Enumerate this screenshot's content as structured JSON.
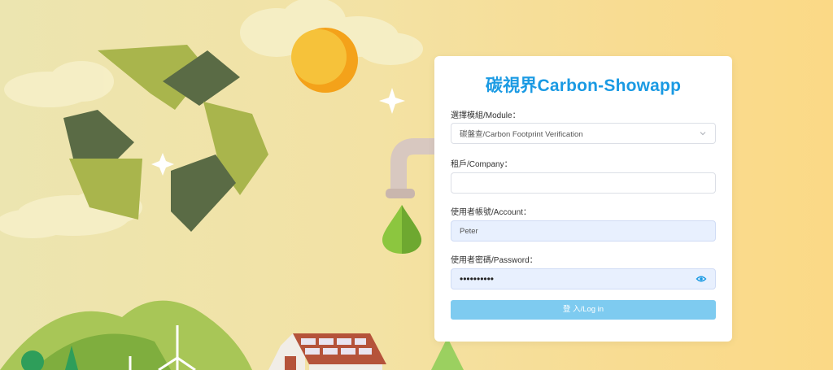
{
  "app": {
    "title": "碳視界Carbon-Showapp"
  },
  "form": {
    "module_label": "選擇模組/Module：",
    "module_value": "碳盤查/Carbon Footprint Verification",
    "company_label": "租戶/Company：",
    "company_value": "",
    "account_label": "使用者帳號/Account：",
    "account_value": "Peter",
    "password_label": "使用者密碼/Password：",
    "password_value": "••••••••••",
    "login_label": "登 入/Log in"
  },
  "icons": {
    "select": "chevron-down-icon",
    "password_toggle": "eye-icon"
  },
  "colors": {
    "accent": "#1a9ae3",
    "button": "#7ecbf0",
    "autofill": "#e8f0fe"
  }
}
